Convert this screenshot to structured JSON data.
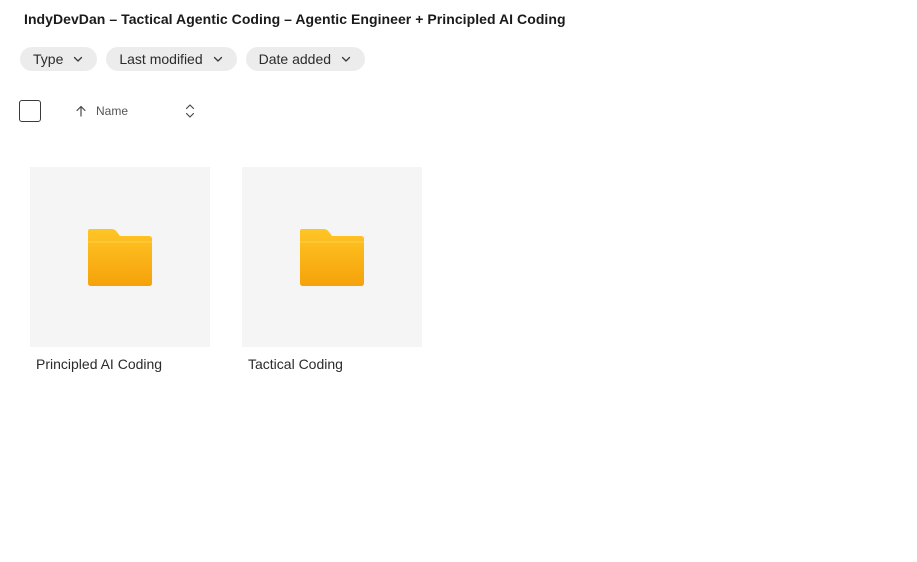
{
  "header": {
    "title": "IndyDevDan – Tactical Agentic Coding – Agentic Engineer + Principled AI Coding"
  },
  "filters": [
    {
      "label": "Type",
      "icon": "chevron-down-icon"
    },
    {
      "label": "Last modified",
      "icon": "chevron-down-icon"
    },
    {
      "label": "Date added",
      "icon": "chevron-down-icon"
    }
  ],
  "list_header": {
    "sort_column": "Name",
    "sort_direction": "ascending",
    "sort_icon": "arrow-up-icon",
    "toggle_icon": "sort-toggle-icon"
  },
  "folders": [
    {
      "name": "Principled AI Coding",
      "icon": "folder-icon"
    },
    {
      "name": "Tactical Coding",
      "icon": "folder-icon"
    }
  ],
  "colors": {
    "folder_top": "#FFC224",
    "folder_bottom": "#F5A30A",
    "chip_bg": "#ECECEC",
    "thumb_bg": "#F5F5F5"
  }
}
